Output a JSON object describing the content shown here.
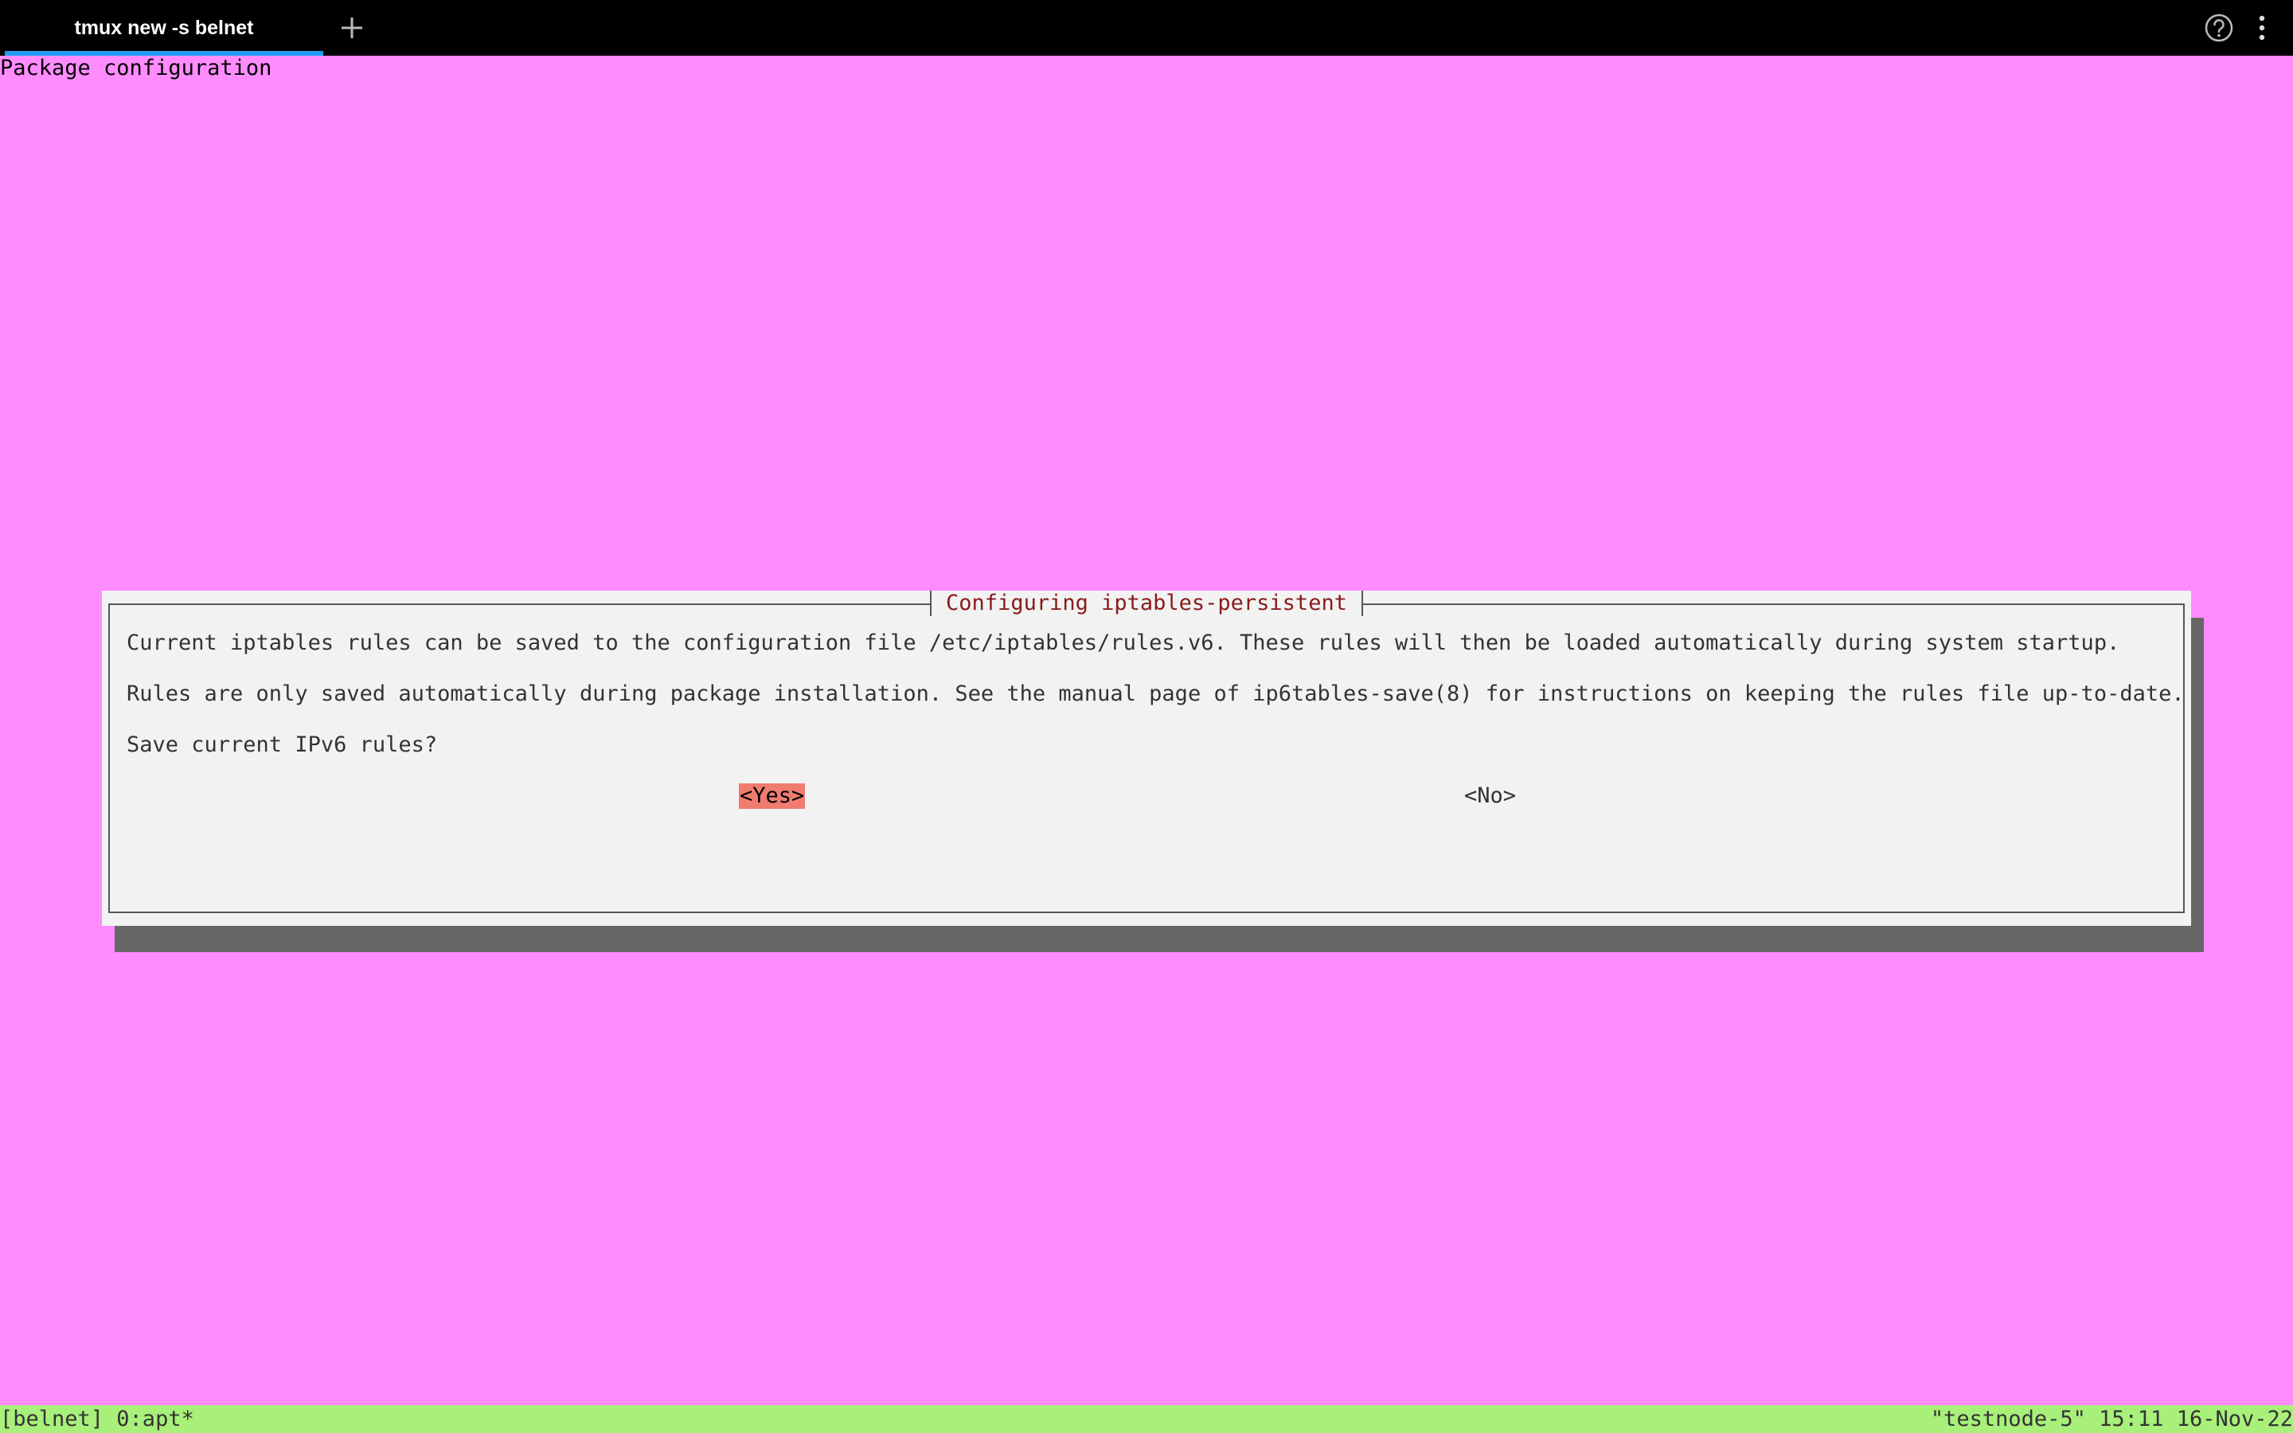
{
  "tabbar": {
    "tabs": [
      {
        "label": "tmux new -s belnet",
        "active": true
      }
    ],
    "new_tab_icon": "plus-icon",
    "help_icon": "help-circle-icon",
    "menu_icon": "vertical-dots-icon",
    "accent_color": "#1e9cf0"
  },
  "terminal": {
    "backtitle": "Package configuration",
    "background_color": "#ff8cff",
    "dialog": {
      "title": "Configuring iptables-persistent",
      "lines": [
        "Current iptables rules can be saved to the configuration file /etc/iptables/rules.v6. These rules will then be loaded automatically during system startup.",
        "Rules are only saved automatically during package installation. See the manual page of ip6tables-save(8) for instructions on keeping the rules file up-to-date.",
        "Save current IPv6 rules?"
      ],
      "buttons": {
        "yes": "<Yes>",
        "no": "<No>",
        "selected": "yes"
      },
      "selected_color": "#f07c70"
    }
  },
  "statusbar": {
    "left": "[belnet] 0:apt*",
    "right": "\"testnode-5\" 15:11 16-Nov-22",
    "background_color": "#a8f07a"
  }
}
